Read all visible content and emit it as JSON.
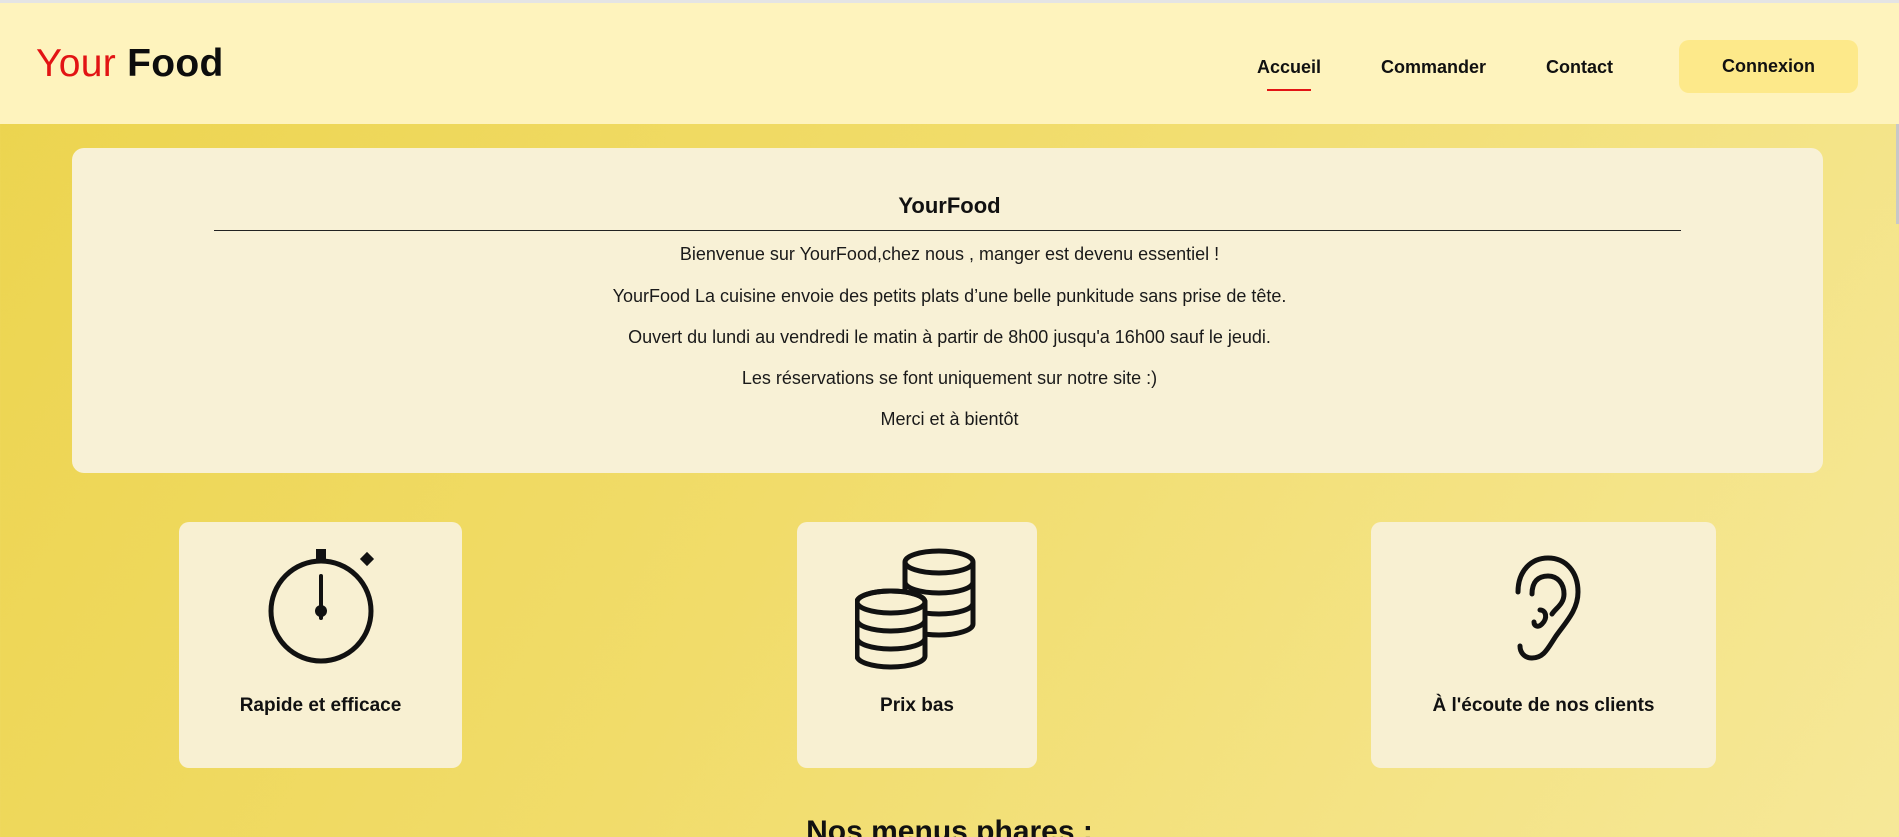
{
  "brand": {
    "part1": "Your",
    "part2": "Food"
  },
  "nav": {
    "items": [
      {
        "label": "Accueil",
        "active": true
      },
      {
        "label": "Commander",
        "active": false
      },
      {
        "label": "Contact",
        "active": false
      }
    ],
    "login_label": "Connexion",
    "active_color": "#e21414"
  },
  "welcome": {
    "title": "YourFood",
    "lines": [
      "Bienvenue sur YourFood,chez nous , manger est devenu essentiel !",
      "YourFood La cuisine envoie des petits plats d’une belle punkitude sans prise de tête.",
      "Ouvert du lundi au vendredi le matin à partir de 8h00 jusqu'a 16h00 sauf le jeudi.",
      "Les réservations se font uniquement sur notre site :)",
      "Merci et à bientôt"
    ]
  },
  "features": [
    {
      "icon": "stopwatch-icon",
      "label": "Rapide et efficace"
    },
    {
      "icon": "coins-icon",
      "label": "Prix bas"
    },
    {
      "icon": "ear-icon",
      "label": "À l'écoute de nos clients"
    }
  ],
  "menus_heading": "Nos menus phares :",
  "colors": {
    "brand_red": "#e21414",
    "navbar_bg": "#fef3bd",
    "button_bg": "#fde98a",
    "card_bg": "#f8f1d6",
    "page_gradient_start": "#ecd44e",
    "page_gradient_end": "#f6e898"
  }
}
